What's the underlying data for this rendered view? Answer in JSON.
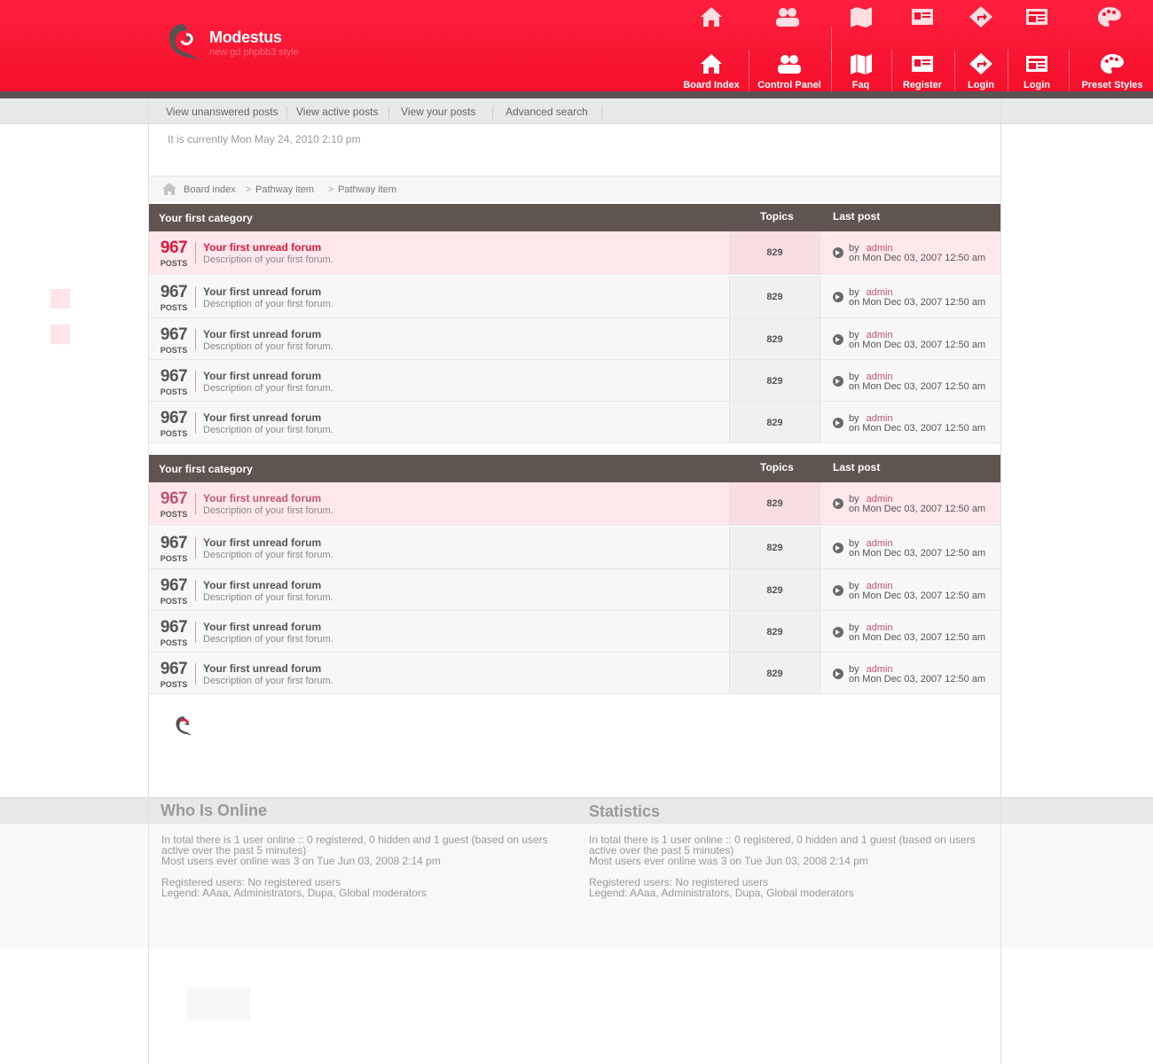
{
  "brand": {
    "name": "Modestus",
    "tagline": "new gd phpbb3 style"
  },
  "nav": [
    {
      "label": "Board Index",
      "icon": "home-icon"
    },
    {
      "label": "Control Panel",
      "icon": "users-icon"
    },
    {
      "label": "Faq",
      "icon": "map-icon"
    },
    {
      "label": "Register",
      "icon": "id-card-icon"
    },
    {
      "label": "Login",
      "icon": "signpost-icon"
    },
    {
      "label": "Login",
      "icon": "newspaper-icon"
    },
    {
      "label": "Preset Styles",
      "icon": "palette-icon"
    }
  ],
  "subnav": [
    "View unanswered posts",
    "View active posts",
    "View your posts",
    "Advanced search"
  ],
  "current_time": "It is currently Mon May 24, 2010 2:10 pm",
  "breadcrumbs": [
    "Board index",
    "Pathway item",
    "Pathway item"
  ],
  "categories": [
    {
      "title": "Your first category",
      "col_topics": "Topics",
      "col_last": "Last post",
      "forums": [
        {
          "posts": "967",
          "posts_label": "POSTS",
          "title": "Your first unread forum",
          "desc": "Description of your first forum.",
          "topics": "829",
          "by": "by",
          "user": "admin",
          "date": "on Mon Dec 03, 2007 12:50 am"
        },
        {
          "posts": "967",
          "posts_label": "POSTS",
          "title": "Your first unread forum",
          "desc": "Description of your first forum.",
          "topics": "829",
          "by": "by",
          "user": "admin",
          "date": "on Mon Dec 03, 2007 12:50 am"
        },
        {
          "posts": "967",
          "posts_label": "POSTS",
          "title": "Your first unread forum",
          "desc": "Description of your first forum.",
          "topics": "829",
          "by": "by",
          "user": "admin",
          "date": "on Mon Dec 03, 2007 12:50 am"
        },
        {
          "posts": "967",
          "posts_label": "POSTS",
          "title": "Your first unread forum",
          "desc": "Description of your first forum.",
          "topics": "829",
          "by": "by",
          "user": "admin",
          "date": "on Mon Dec 03, 2007 12:50 am"
        },
        {
          "posts": "967",
          "posts_label": "POSTS",
          "title": "Your first unread forum",
          "desc": "Description of your first forum.",
          "topics": "829",
          "by": "by",
          "user": "admin",
          "date": "on Mon Dec 03, 2007 12:50 am"
        }
      ]
    },
    {
      "title": "Your first category",
      "col_topics": "Topics",
      "col_last": "Last post",
      "forums": [
        {
          "posts": "967",
          "posts_label": "POSTS",
          "title": "Your first unread forum",
          "desc": "Description of your first forum.",
          "topics": "829",
          "by": "by",
          "user": "admin",
          "date": "on Mon Dec 03, 2007 12:50 am"
        },
        {
          "posts": "967",
          "posts_label": "POSTS",
          "title": "Your first unread forum",
          "desc": "Description of your first forum.",
          "topics": "829",
          "by": "by",
          "user": "admin",
          "date": "on Mon Dec 03, 2007 12:50 am"
        },
        {
          "posts": "967",
          "posts_label": "POSTS",
          "title": "Your first unread forum",
          "desc": "Description of your first forum.",
          "topics": "829",
          "by": "by",
          "user": "admin",
          "date": "on Mon Dec 03, 2007 12:50 am"
        },
        {
          "posts": "967",
          "posts_label": "POSTS",
          "title": "Your first unread forum",
          "desc": "Description of your first forum.",
          "topics": "829",
          "by": "by",
          "user": "admin",
          "date": "on Mon Dec 03, 2007 12:50 am"
        },
        {
          "posts": "967",
          "posts_label": "POSTS",
          "title": "Your first unread forum",
          "desc": "Description of your first forum.",
          "topics": "829",
          "by": "by",
          "user": "admin",
          "date": "on Mon Dec 03, 2007 12:50 am"
        }
      ]
    }
  ],
  "footer": {
    "who_title": "Who Is Online",
    "stats_title": "Statistics",
    "line1": "In total there is 1 user online :: 0 registered, 0 hidden and 1 guest (based on users",
    "line2": "active over the past 5 minutes)",
    "line3": "Most users ever online was 3 on Tue Jun 03, 2008 2:14 pm",
    "line4": "Registered users: No registered users",
    "line5": "Legend: AAaa, Administrators, Dupa, Global moderators"
  },
  "colors": {
    "brand_red": "#f5102c",
    "category_header": "#605451",
    "unread_red": "#e0173c",
    "user_link": "#c0566e"
  }
}
